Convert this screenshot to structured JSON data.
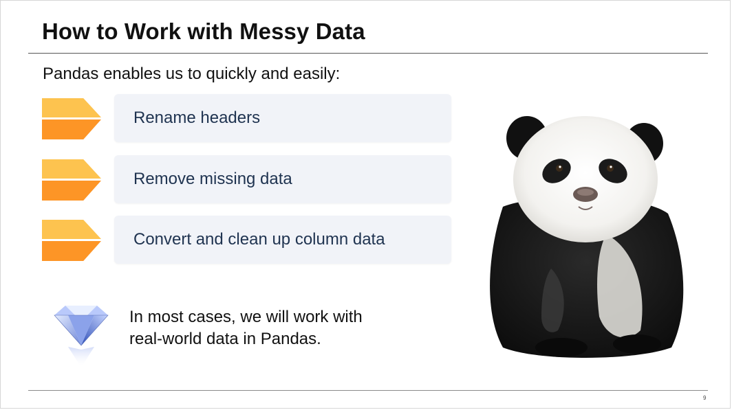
{
  "slide": {
    "title": "How to Work with Messy Data",
    "subtitle": "Pandas enables us to quickly and easily:",
    "bullets": [
      {
        "label": "Rename headers"
      },
      {
        "label": "Remove missing data"
      },
      {
        "label": "Convert and clean up column data"
      }
    ],
    "note_lines": [
      "In most cases, we will work with",
      "real-world data in Pandas."
    ],
    "page_number": "9"
  },
  "icons": {
    "bullet_marker": "chevron-arrow-icon",
    "note_marker": "diamond-icon",
    "photo": "panda-image"
  },
  "colors": {
    "chevron_top": "#fdc34f",
    "chevron_bottom": "#fd9526",
    "bullet_box": "#f1f3f8",
    "bullet_text": "#1f3350"
  }
}
